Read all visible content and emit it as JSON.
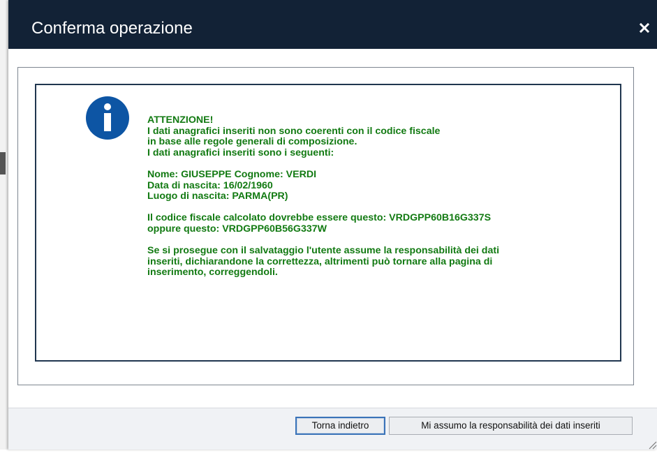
{
  "dialog": {
    "title": "Conferma operazione",
    "close_icon": "close-icon",
    "info_icon": "info-icon"
  },
  "message": {
    "lines": [
      "ATTENZIONE!",
      "I dati anagrafici inseriti non sono coerenti con il codice fiscale",
      "in base alle regole generali di composizione.",
      "I dati anagrafici inseriti sono i seguenti:",
      "",
      "Nome: GIUSEPPE Cognome: VERDI",
      "Data di nascita: 16/02/1960",
      "Luogo di nascita: PARMA(PR)",
      "",
      "Il codice fiscale calcolato dovrebbe essere questo: VRDGPP60B16G337S",
      "oppure questo: VRDGPP60B56G337W",
      "",
      "Se si prosegue con il salvataggio l'utente assume la responsabilità dei dati",
      "inseriti, dichiarandone la correttezza, altrimenti può tornare alla pagina di",
      "inserimento, correggendoli."
    ]
  },
  "buttons": {
    "back_label": "Torna indietro",
    "confirm_label": "Mi assumo la responsabilità dei dati inseriti"
  },
  "colors": {
    "titlebar": "#122236",
    "message_text": "#127a12",
    "info_icon": "#0d55a4",
    "message_border": "#20364f"
  }
}
